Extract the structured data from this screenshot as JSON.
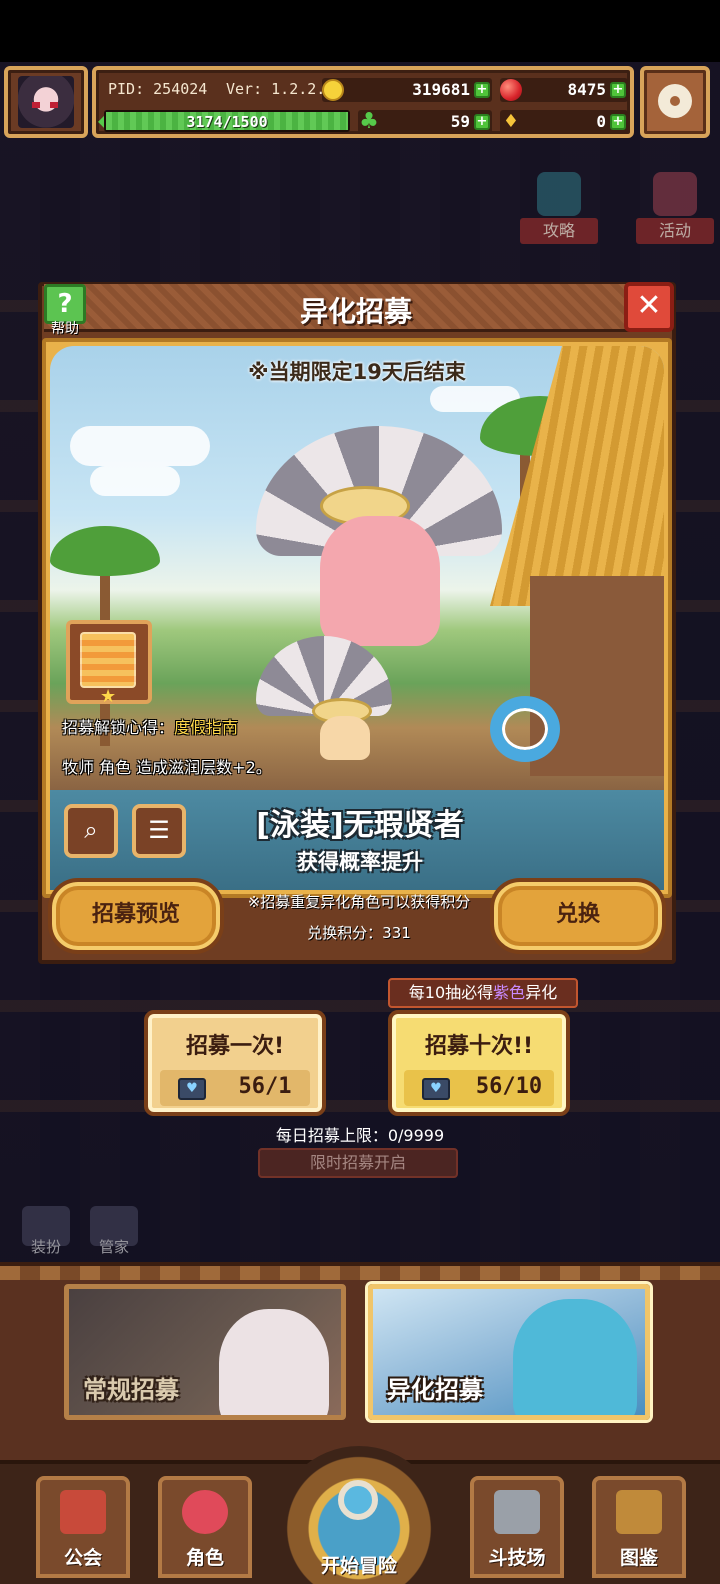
{
  "hud": {
    "pid": "PID: 254024",
    "version": "Ver: 1.2.2.6",
    "gold": "319681",
    "gems": "8475",
    "clover": "59",
    "tickets": "0",
    "stamina": "3174/1500",
    "stamina_fill_fraction": 1.0
  },
  "side_buttons": {
    "guide": "攻略",
    "event": "活动"
  },
  "dialog": {
    "title": "异化招募",
    "help_label": "帮助",
    "limit_notice": "※当期限定19天后结束",
    "unlock_prefix": "招募解锁心得：",
    "unlock_name": "度假指南",
    "skill_text": "牧师 角色 造成滋润层数+2。",
    "hero_name": "[泳装]无瑕贤者",
    "rate_up": "获得概率提升",
    "preview_button": "招募预览",
    "exchange_button": "兑换",
    "duplicate_note": "※招募重复异化角色可以获得积分",
    "points_label": "兑换积分：331"
  },
  "draw": {
    "guarantee_prefix": "每10抽必得",
    "guarantee_color": "紫色",
    "guarantee_suffix": "异化",
    "once_label": "招募一次!",
    "once_cost": "56/1",
    "ten_label": "招募十次!!",
    "ten_cost": "56/10",
    "daily_limit": "每日招募上限：0/9999",
    "limited_open": "限时招募开启"
  },
  "dim_buttons": {
    "outfit": "装扮",
    "butler": "管家"
  },
  "tabs": {
    "normal": "常规招募",
    "special": "异化招募"
  },
  "nav": {
    "guild": "公会",
    "character": "角色",
    "adventure": "开始冒险",
    "arena": "斗技场",
    "codex": "图鉴"
  }
}
